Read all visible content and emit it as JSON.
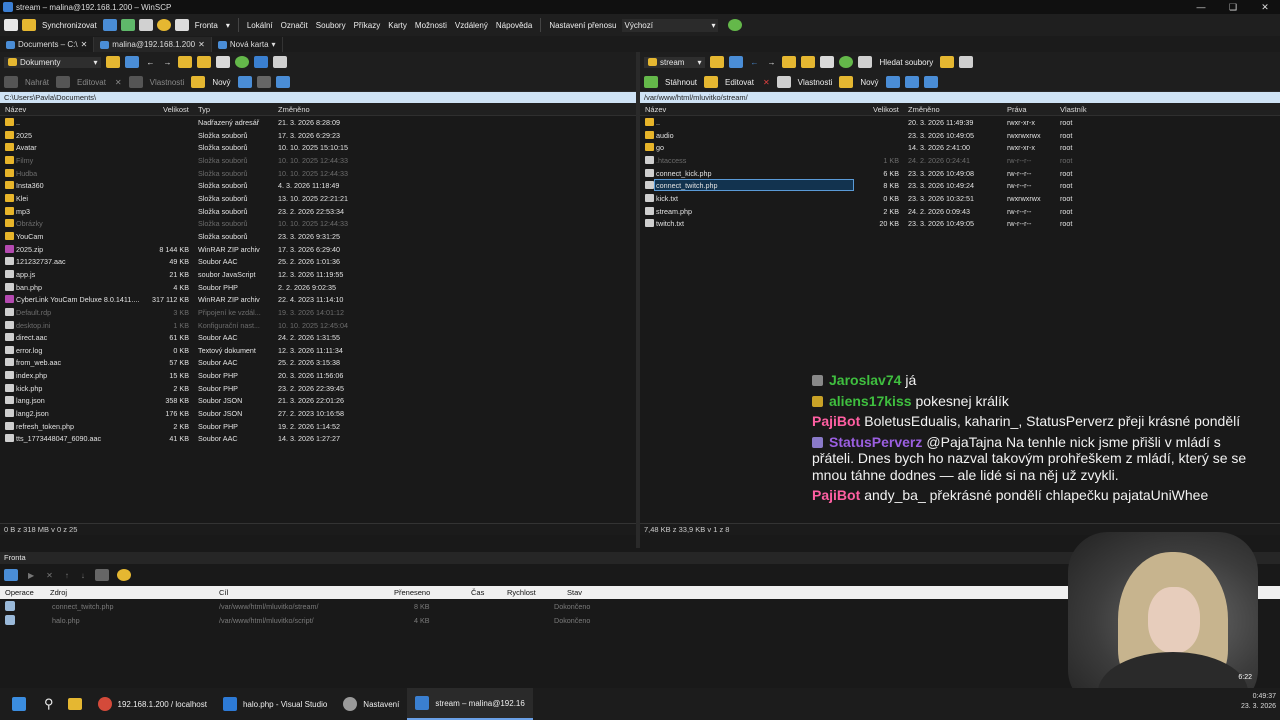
{
  "window": {
    "title": "stream – malina@192.168.1.200 – WinSCP"
  },
  "menubar": {
    "sync_label": "Synchronizovat",
    "queue_label": "Fronta",
    "items": [
      "Lokální",
      "Označit",
      "Soubory",
      "Příkazy",
      "Karty",
      "Možnosti",
      "Vzdálený",
      "Nápověda"
    ],
    "transfer_label": "Nastavení přenosu",
    "transfer_value": "Výchozí"
  },
  "tabs": [
    {
      "label": "Documents – C:\\"
    },
    {
      "label": "malina@192.168.1.200"
    },
    {
      "label": "Nová karta"
    }
  ],
  "left": {
    "location": "Dokumenty",
    "toolbar": {
      "upload": "Nahrát",
      "edit": "Editovat",
      "props": "Vlastnosti",
      "new": "Nový"
    },
    "path": "C:\\Users\\Pavla\\Documents\\",
    "columns": {
      "name": "Název",
      "size": "Velikost",
      "type": "Typ",
      "modified": "Změněno"
    },
    "files": [
      {
        "name": "..",
        "size": "",
        "type": "Nadřazený adresář",
        "modified": "21. 3. 2026 8:28:09",
        "kind": "up",
        "dim": false
      },
      {
        "name": "2025",
        "size": "",
        "type": "Složka souborů",
        "modified": "17. 3. 2026 6:29:23",
        "kind": "folder",
        "dim": false
      },
      {
        "name": "Avatar",
        "size": "",
        "type": "Složka souborů",
        "modified": "10. 10. 2025 15:10:15",
        "kind": "folder",
        "dim": false
      },
      {
        "name": "Filmy",
        "size": "",
        "type": "Složka souborů",
        "modified": "10. 10. 2025 12:44:33",
        "kind": "folder",
        "dim": true
      },
      {
        "name": "Hudba",
        "size": "",
        "type": "Složka souborů",
        "modified": "10. 10. 2025 12:44:33",
        "kind": "folder",
        "dim": true
      },
      {
        "name": "Insta360",
        "size": "",
        "type": "Složka souborů",
        "modified": "4. 3. 2026 11:18:49",
        "kind": "folder",
        "dim": false
      },
      {
        "name": "Klei",
        "size": "",
        "type": "Složka souborů",
        "modified": "13. 10. 2025 22:21:21",
        "kind": "folder",
        "dim": false
      },
      {
        "name": "mp3",
        "size": "",
        "type": "Složka souborů",
        "modified": "23. 2. 2026 22:53:34",
        "kind": "folder",
        "dim": false
      },
      {
        "name": "Obrázky",
        "size": "",
        "type": "Složka souborů",
        "modified": "10. 10. 2025 12:44:33",
        "kind": "folder",
        "dim": true
      },
      {
        "name": "YouCam",
        "size": "",
        "type": "Složka souborů",
        "modified": "23. 3. 2026 9:31:25",
        "kind": "folder",
        "dim": false
      },
      {
        "name": "2025.zip",
        "size": "8 144 KB",
        "type": "WinRAR ZIP archiv",
        "modified": "17. 3. 2026 6:29:40",
        "kind": "zip",
        "dim": false
      },
      {
        "name": "121232737.aac",
        "size": "49 KB",
        "type": "Soubor AAC",
        "modified": "25. 2. 2026 1:01:36",
        "kind": "file",
        "dim": false
      },
      {
        "name": "app.js",
        "size": "21 KB",
        "type": "soubor JavaScript",
        "modified": "12. 3. 2026 11:19:55",
        "kind": "file",
        "dim": false
      },
      {
        "name": "ban.php",
        "size": "4 KB",
        "type": "Soubor PHP",
        "modified": "2. 2. 2026 9:02:35",
        "kind": "file",
        "dim": false
      },
      {
        "name": "CyberLink YouCam Deluxe 8.0.1411....",
        "size": "317 112 KB",
        "type": "WinRAR ZIP archiv",
        "modified": "22. 4. 2023 11:14:10",
        "kind": "zip",
        "dim": false
      },
      {
        "name": "Default.rdp",
        "size": "3 KB",
        "type": "Připojení ke vzdál...",
        "modified": "19. 3. 2026 14:01:12",
        "kind": "file",
        "dim": true
      },
      {
        "name": "desktop.ini",
        "size": "1 KB",
        "type": "Konfigurační nast...",
        "modified": "10. 10. 2025 12:45:04",
        "kind": "file",
        "dim": true
      },
      {
        "name": "direct.aac",
        "size": "61 KB",
        "type": "Soubor AAC",
        "modified": "24. 2. 2026 1:31:55",
        "kind": "file",
        "dim": false
      },
      {
        "name": "error.log",
        "size": "0 KB",
        "type": "Textový dokument",
        "modified": "12. 3. 2026 11:11:34",
        "kind": "file",
        "dim": false
      },
      {
        "name": "from_web.aac",
        "size": "57 KB",
        "type": "Soubor AAC",
        "modified": "25. 2. 2026 3:15:38",
        "kind": "file",
        "dim": false
      },
      {
        "name": "index.php",
        "size": "15 KB",
        "type": "Soubor PHP",
        "modified": "20. 3. 2026 11:56:06",
        "kind": "file",
        "dim": false
      },
      {
        "name": "kick.php",
        "size": "2 KB",
        "type": "Soubor PHP",
        "modified": "23. 2. 2026 22:39:45",
        "kind": "file",
        "dim": false
      },
      {
        "name": "lang.json",
        "size": "358 KB",
        "type": "Soubor JSON",
        "modified": "21. 3. 2026 22:01:26",
        "kind": "file",
        "dim": false
      },
      {
        "name": "lang2.json",
        "size": "176 KB",
        "type": "Soubor JSON",
        "modified": "27. 2. 2023 10:16:58",
        "kind": "file",
        "dim": false
      },
      {
        "name": "refresh_token.php",
        "size": "2 KB",
        "type": "Soubor PHP",
        "modified": "19. 2. 2026 1:14:52",
        "kind": "file",
        "dim": false
      },
      {
        "name": "tts_1773448047_6090.aac",
        "size": "41 KB",
        "type": "Soubor AAC",
        "modified": "14. 3. 2026 1:27:27",
        "kind": "file",
        "dim": false
      }
    ],
    "status": "0 B z 318 MB v 0 z 25"
  },
  "right": {
    "location": "stream",
    "find_label": "Hledat soubory",
    "toolbar": {
      "download": "Stáhnout",
      "edit": "Editovat",
      "props": "Vlastnosti",
      "new": "Nový"
    },
    "path": "/var/www/html/mluvitko/stream/",
    "columns": {
      "name": "Název",
      "size": "Velikost",
      "modified": "Změněno",
      "rights": "Práva",
      "owner": "Vlastník"
    },
    "files": [
      {
        "name": "..",
        "size": "",
        "modified": "20. 3. 2026 11:49:39",
        "rights": "rwxr-xr-x",
        "owner": "root",
        "kind": "up",
        "dim": false,
        "sel": false
      },
      {
        "name": "audio",
        "size": "",
        "modified": "23. 3. 2026 10:49:05",
        "rights": "rwxrwxrwx",
        "owner": "root",
        "kind": "folder",
        "dim": false,
        "sel": false
      },
      {
        "name": "go",
        "size": "",
        "modified": "14. 3. 2026 2:41:00",
        "rights": "rwxr-xr-x",
        "owner": "root",
        "kind": "folder",
        "dim": false,
        "sel": false
      },
      {
        "name": ".htaccess",
        "size": "1 KB",
        "modified": "24. 2. 2026 0:24:41",
        "rights": "rw-r--r--",
        "owner": "root",
        "kind": "file",
        "dim": true,
        "sel": false
      },
      {
        "name": "connect_kick.php",
        "size": "6 KB",
        "modified": "23. 3. 2026 10:49:08",
        "rights": "rw-r--r--",
        "owner": "root",
        "kind": "file",
        "dim": false,
        "sel": false
      },
      {
        "name": "connect_twitch.php",
        "size": "8 KB",
        "modified": "23. 3. 2026 10:49:24",
        "rights": "rw-r--r--",
        "owner": "root",
        "kind": "file",
        "dim": false,
        "sel": true
      },
      {
        "name": "kick.txt",
        "size": "0 KB",
        "modified": "23. 3. 2026 10:32:51",
        "rights": "rwxrwxrwx",
        "owner": "root",
        "kind": "file",
        "dim": false,
        "sel": false
      },
      {
        "name": "stream.php",
        "size": "2 KB",
        "modified": "24. 2. 2026 0:09:43",
        "rights": "rw-r--r--",
        "owner": "root",
        "kind": "file",
        "dim": false,
        "sel": false
      },
      {
        "name": "twitch.txt",
        "size": "20 KB",
        "modified": "23. 3. 2026 10:49:05",
        "rights": "rw-r--r--",
        "owner": "root",
        "kind": "file",
        "dim": false,
        "sel": false
      }
    ],
    "status": "7,48 KB z 33,9 KB v 1 z 8"
  },
  "queue": {
    "title": "Fronta",
    "columns": {
      "op": "Operace",
      "src": "Zdroj",
      "dst": "Cíl",
      "transferred": "Přeneseno",
      "time": "Čas",
      "speed": "Rychlost",
      "state": "Stav"
    },
    "items": [
      {
        "src": "connect_twitch.php",
        "dst": "/var/www/html/mluvitko/stream/",
        "transferred": "8 KB",
        "state": "Dokončeno"
      },
      {
        "src": "halo.php",
        "dst": "/var/www/html/mluvitko/script/",
        "transferred": "4 KB",
        "state": "Dokončeno"
      }
    ]
  },
  "chat": [
    {
      "user": "Jaroslav74",
      "text": "já",
      "color": "#3fbf3f",
      "badge": "#888888"
    },
    {
      "user": "aliens17kiss",
      "text": "pokesnej králík",
      "color": "#3fbf3f",
      "badge": "#c9a227"
    },
    {
      "user": "PajiBot",
      "text": "BoletusEdualis, kaharin_, StatusPerverz přeji krásné pondělí",
      "color": "#ff5fa2",
      "badge": ""
    },
    {
      "user": "StatusPerverz",
      "text": "@PajaTajna Na tenhle nick jsme přišli v mládí s přáteli. Dnes bych ho nazval takovým prohřeškem z mládí, který se se mnou táhne dodnes — ale lidé si na něj už zvykli.",
      "color": "#9b5fe0",
      "badge": "#8a7ac9"
    },
    {
      "user": "PajiBot",
      "text": "andy_ba_ překrásné pondělí chlapečku pajataUniWhee",
      "color": "#ff5fa2",
      "badge": ""
    }
  ],
  "taskbar": {
    "apps": [
      {
        "label": "192.168.1.200 / localhost"
      },
      {
        "label": "halo.php - Visual Studio"
      },
      {
        "label": "Nastavení"
      },
      {
        "label": "stream – malina@192.16"
      }
    ],
    "clock_time": "0:49:37",
    "clock_date": "23. 3. 2026",
    "cam_overlay": "6:22"
  }
}
